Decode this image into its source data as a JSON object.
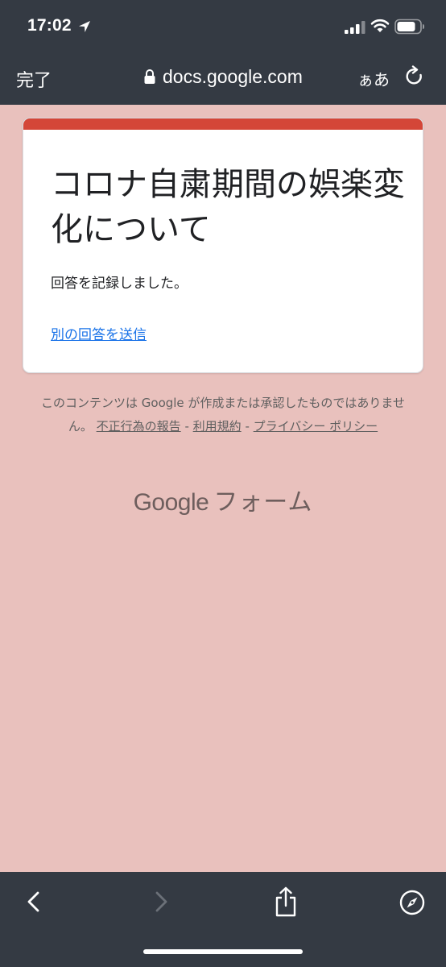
{
  "status_bar": {
    "time": "17:02"
  },
  "browser": {
    "done_label": "完了",
    "url": "docs.google.com",
    "text_size_label": "ぁあ"
  },
  "form": {
    "title": "コロナ自粛期間の娯楽変化について",
    "confirmation": "回答を記録しました。",
    "another_response_link": "別の回答を送信"
  },
  "footer": {
    "disclaimer_text": "このコンテンツは Google が作成または承認したものではありません。",
    "report_abuse": "不正行為の報告",
    "separator": "-",
    "terms": "利用規約",
    "privacy": "プライバシー ポリシー",
    "logo_google": "Google",
    "logo_forms": "フォーム"
  },
  "colors": {
    "chrome_bg": "#343a43",
    "page_bg": "#e9c1bd",
    "accent": "#d44638",
    "link": "#1a73e8"
  },
  "icons": [
    "location-arrow-icon",
    "signal-icon",
    "wifi-icon",
    "battery-icon",
    "lock-icon",
    "reload-icon",
    "back-icon",
    "forward-icon",
    "share-icon",
    "compass-icon"
  ]
}
